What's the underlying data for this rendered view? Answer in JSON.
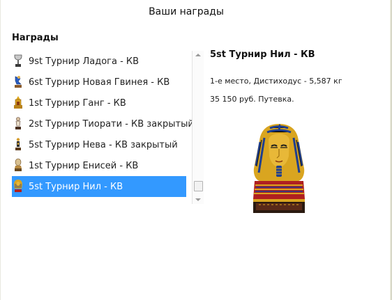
{
  "window": {
    "title": "Ваши награды"
  },
  "awards": {
    "heading": "Награды",
    "items": [
      {
        "label": "9st Турнир Ладога - КВ",
        "icon": "cup-trophy-icon",
        "selected": false
      },
      {
        "label": "6st Турнир Новая Гвинея - КВ",
        "icon": "blue-figure-trophy-icon",
        "selected": false
      },
      {
        "label": "1st Турнир Ганг - КВ",
        "icon": "golden-temple-trophy-icon",
        "selected": false
      },
      {
        "label": "2st Турнир Тиорати - КВ закрытый",
        "icon": "statue-trophy-icon",
        "selected": false
      },
      {
        "label": "5st Турнир Нева - КВ закрытый",
        "icon": "figurine-trophy-icon",
        "selected": false
      },
      {
        "label": "1st Турнир Енисей - КВ",
        "icon": "bust-trophy-icon",
        "selected": false
      },
      {
        "label": "5st Турнир Нил - КВ",
        "icon": "pharaoh-trophy-icon",
        "selected": true
      }
    ]
  },
  "detail": {
    "title": "5st Турнир Нил - КВ",
    "line1": "1-е место, Дистиходус - 5,587 кг",
    "line2": "35 150 руб. Путевка.",
    "image": "pharaoh-bust-image"
  },
  "colors": {
    "selection": "#3399ff",
    "gold": "#d9a520",
    "blue_stripe": "#1f3f8f",
    "red_base": "#b02020"
  }
}
